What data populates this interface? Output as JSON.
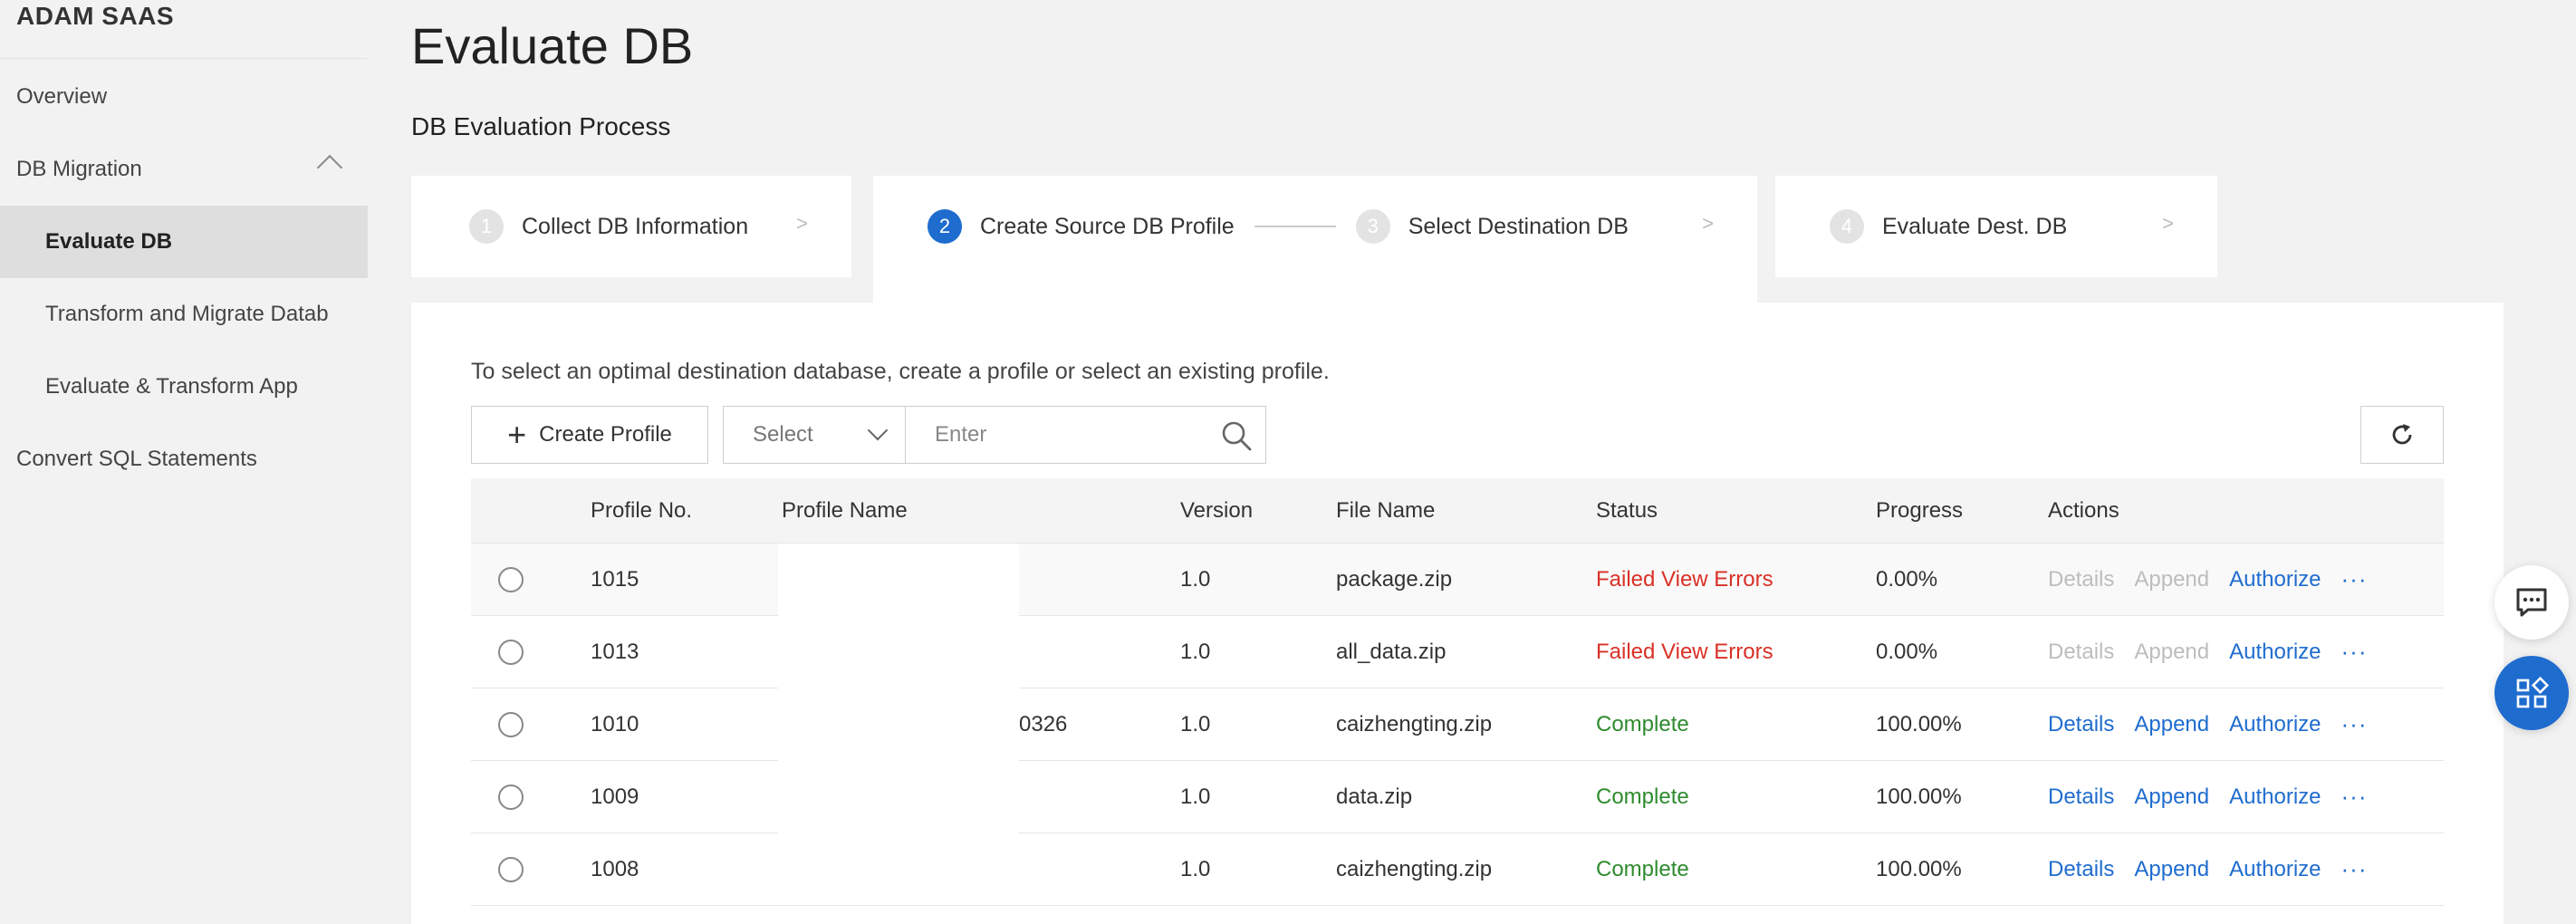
{
  "brand": "ADAM SAAS",
  "sidebar": {
    "items": [
      {
        "label": "Overview"
      },
      {
        "label": "DB Migration"
      },
      {
        "label": "Evaluate DB"
      },
      {
        "label": "Transform and Migrate Datab"
      },
      {
        "label": "Evaluate & Transform App"
      },
      {
        "label": "Convert SQL Statements"
      }
    ]
  },
  "page": {
    "title": "Evaluate DB",
    "section_title": "DB Evaluation Process",
    "description": "To select an optimal destination database, create a profile or select an existing profile."
  },
  "steps": [
    {
      "num": "1",
      "label": "Collect DB Information"
    },
    {
      "num": "2",
      "label": "Create Source DB Profile"
    },
    {
      "num": "3",
      "label": "Select Destination DB"
    },
    {
      "num": "4",
      "label": "Evaluate Dest. DB"
    }
  ],
  "step_arrow": ">",
  "toolbar": {
    "create_label": "Create Profile",
    "select_placeholder": "Select",
    "search_placeholder": "Enter"
  },
  "table": {
    "headers": [
      "Profile No.",
      "Profile Name",
      "Version",
      "File Name",
      "Status",
      "Progress",
      "Actions"
    ],
    "rows": [
      {
        "no": "1015",
        "name": "",
        "version": "1.0",
        "file": "package.zip",
        "status": "Failed View Errors",
        "progress": "0.00%"
      },
      {
        "no": "1013",
        "name": "",
        "version": "1.0",
        "file": "all_data.zip",
        "status": "Failed View Errors",
        "progress": "0.00%"
      },
      {
        "no": "1010",
        "name": "0326",
        "version": "1.0",
        "file": "caizhengting.zip",
        "status": "Complete",
        "progress": "100.00%"
      },
      {
        "no": "1009",
        "name": "",
        "version": "1.0",
        "file": "data.zip",
        "status": "Complete",
        "progress": "100.00%"
      },
      {
        "no": "1008",
        "name": "",
        "version": "1.0",
        "file": "caizhengting.zip",
        "status": "Complete",
        "progress": "100.00%"
      }
    ],
    "actions": {
      "details": "Details",
      "append": "Append",
      "authorize": "Authorize",
      "more": "···"
    }
  },
  "colors": {
    "accent": "#1f6ccf",
    "failed": "#d93026",
    "complete": "#2e8b2e"
  }
}
